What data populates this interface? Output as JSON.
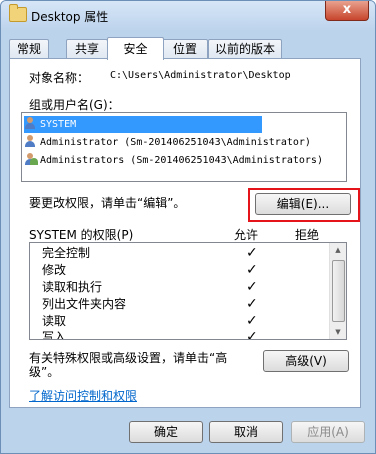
{
  "window": {
    "title": "Desktop 属性",
    "close_symbol": "x"
  },
  "tabs": [
    {
      "label": "常规"
    },
    {
      "label": "共享"
    },
    {
      "label": "安全"
    },
    {
      "label": "位置"
    },
    {
      "label": "以前的版本"
    }
  ],
  "object": {
    "label": "对象名称：",
    "value": "C:\\Users\\Administrator\\Desktop"
  },
  "groups": {
    "label": "组或用户名(G)：",
    "items": [
      {
        "icon": "system-user-icon",
        "name": "SYSTEM"
      },
      {
        "icon": "user-icon",
        "name": "Administrator (Sm-201406251043\\Administrator)"
      },
      {
        "icon": "group-icon",
        "name": "Administrators (Sm-201406251043\\Administrators)"
      }
    ]
  },
  "change_hint": "要更改权限，请单击“编辑”。",
  "edit_button": "编辑(E)...",
  "permissions": {
    "title": "SYSTEM 的权限(P)",
    "allow_header": "允许",
    "deny_header": "拒绝",
    "rows": [
      {
        "name": "完全控制",
        "allow": "✓"
      },
      {
        "name": "修改",
        "allow": "✓"
      },
      {
        "name": "读取和执行",
        "allow": "✓"
      },
      {
        "name": "列出文件夹内容",
        "allow": "✓"
      },
      {
        "name": "读取",
        "allow": "✓"
      },
      {
        "name": "写入",
        "allow": "✓"
      }
    ]
  },
  "special": {
    "text_line1": "有关特殊权限或高级设置，请单击“高",
    "text_line2": "级”。",
    "advanced_button": "高级(V)"
  },
  "link": "了解访问控制和权限",
  "footer": {
    "ok": "确定",
    "cancel": "取消",
    "apply": "应用(A)"
  },
  "colors": {
    "highlight": "#e5141a",
    "selection": "#3399ff",
    "link": "#0066cc"
  }
}
